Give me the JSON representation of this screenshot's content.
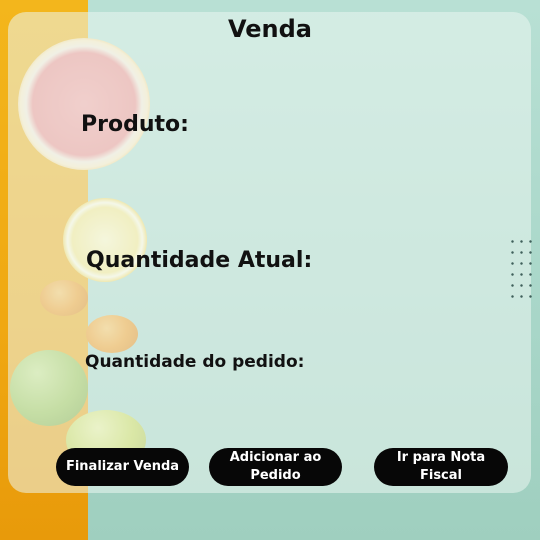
{
  "title": "Venda",
  "labels": {
    "product": "Produto:",
    "current_quantity": "Quantidade Atual:",
    "order_quantity": "Quantidade do pedido:"
  },
  "buttons": {
    "finalize": "Finalizar Venda",
    "add": "Adicionar ao Pedido",
    "invoice": "Ir para Nota Fiscal"
  },
  "colors": {
    "button_bg": "#070707",
    "left_strip": "#f3b61c",
    "background": "#b8e0d4"
  }
}
